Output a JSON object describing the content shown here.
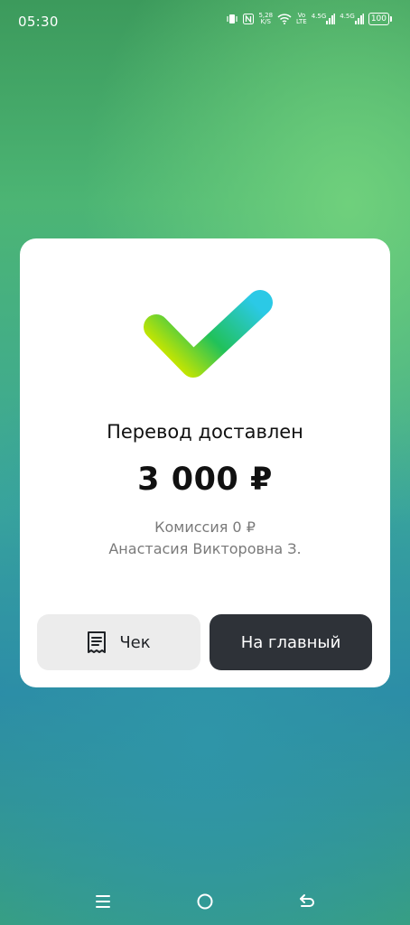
{
  "status_bar": {
    "time": "05:30",
    "speed_value": "5,28",
    "speed_unit": "K/S",
    "volte_top": "Vo",
    "volte_bottom": "LTE",
    "sim1": "4.5G",
    "sim2": "4.5G",
    "battery": "100"
  },
  "result": {
    "title": "Перевод доставлен",
    "amount": "3 000 ₽",
    "commission": "Комиссия 0 ₽",
    "recipient": "Анастасия Викторовна З."
  },
  "actions": {
    "receipt_label": "Чек",
    "home_label": "На главный"
  },
  "icons": {
    "status_check": "check-icon",
    "receipt": "receipt-icon",
    "nav_menu": "menu-icon",
    "nav_home": "home-circle-icon",
    "nav_back": "back-icon"
  },
  "colors": {
    "card_bg": "#ffffff",
    "primary_button": "#2e3238",
    "secondary_button": "#ececec",
    "check_gradient_start": "#c6e600",
    "check_gradient_mid": "#21c15a",
    "check_gradient_end": "#2bc9e6"
  }
}
